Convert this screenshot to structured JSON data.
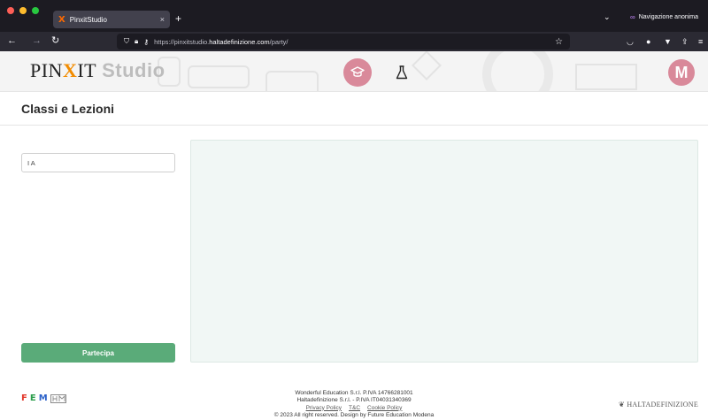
{
  "browser": {
    "tab_title": "PinxitStudio",
    "tab_favicon": "X",
    "tab_close": "×",
    "new_tab": "+",
    "private_label": "Navigazione anonima",
    "url_prefix": "https://pinxitstudio.",
    "url_host": "haltadefinizione.com",
    "url_path": "/party/"
  },
  "header": {
    "logo_main_a": "PIN",
    "logo_x": "X",
    "logo_main_b": "IT",
    "logo_studio": "Studio",
    "avatar_letter": "M"
  },
  "page": {
    "title": "Classi e Lezioni"
  },
  "form": {
    "class_code_value": "I A",
    "join_label": "Partecipa"
  },
  "footer": {
    "line1": "Wonderful Education S.r.l. P.IVA 14766281001",
    "line2": "Haltadefinizione S.r.l. - P.IVA IT04031340369",
    "links": [
      "Privacy Policy",
      "T&C",
      "Cookie Policy"
    ],
    "line4": "© 2023 All right reserved. Design by Future Education Modena",
    "partner_logo": "HALTADEFINIZIONE"
  },
  "colors": {
    "accent_pink": "#d9899a",
    "join_green": "#5aab79",
    "panel_bg": "#f1f7f5"
  },
  "icons": [
    "back-icon",
    "forward-icon",
    "reload-icon",
    "shield-icon",
    "lock-icon",
    "key-icon",
    "star-icon",
    "pocket-icon",
    "extension-icon",
    "filter-icon",
    "share-icon",
    "menu-icon",
    "graduation-cap-icon",
    "flask-icon",
    "private-mask-icon",
    "chevron-down-icon"
  ]
}
